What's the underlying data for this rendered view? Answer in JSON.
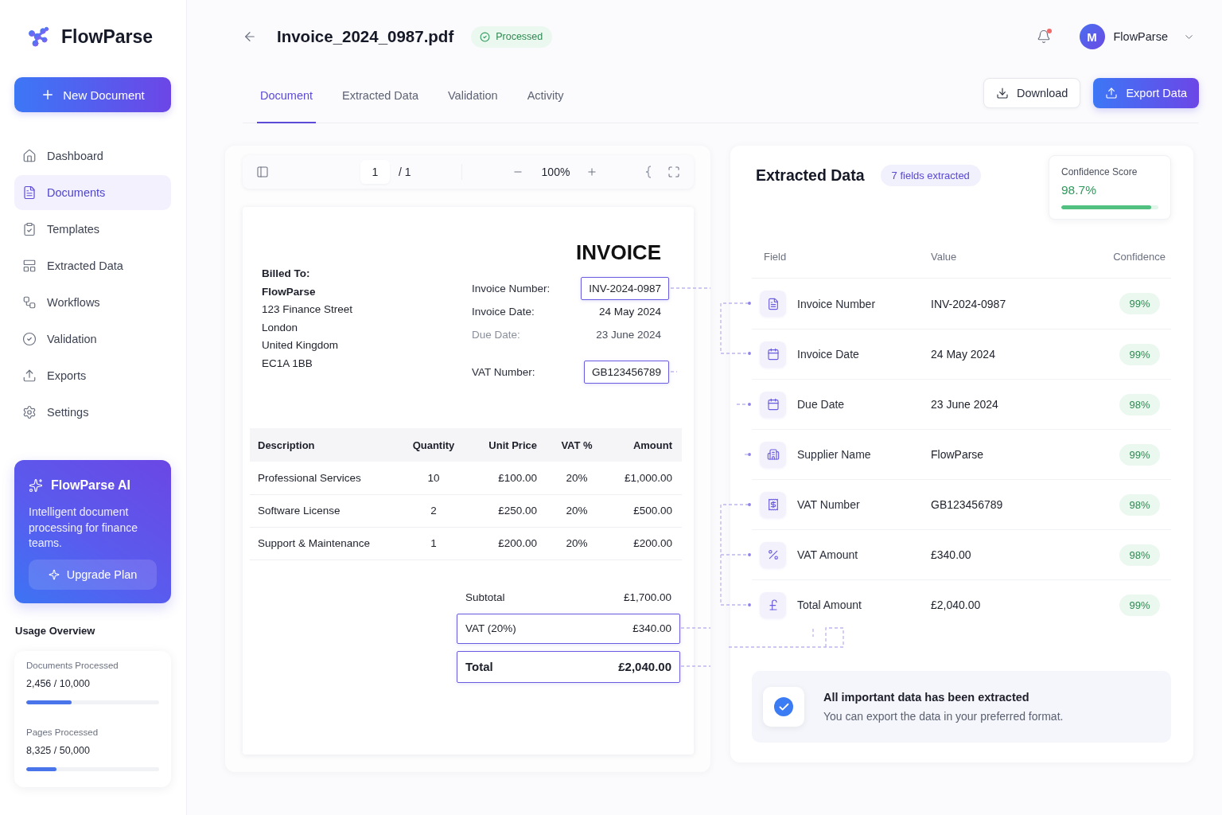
{
  "sidebar": {
    "brand": "FlowParse",
    "new_button": "New Document",
    "nav": [
      {
        "label": "Dashboard",
        "selected": false
      },
      {
        "label": "Documents",
        "selected": true
      },
      {
        "label": "Templates",
        "selected": false
      },
      {
        "label": "Extracted Data",
        "selected": false
      },
      {
        "label": "Workflows",
        "selected": false
      },
      {
        "label": "Validation",
        "selected": false
      },
      {
        "label": "Exports",
        "selected": false
      },
      {
        "label": "Settings",
        "selected": false
      }
    ],
    "promo": {
      "title": "FlowParse AI",
      "text": "Intelligent document processing for finance teams.",
      "button": "Upgrade Plan"
    },
    "usage": {
      "title": "Usage Overview",
      "meters": [
        {
          "label": "Documents Processed",
          "reading": "2,456 / 10,000",
          "level": 0.34
        },
        {
          "label": "Pages Processed",
          "reading": "8,325 / 50,000",
          "level": 0.23
        }
      ]
    }
  },
  "header": {
    "title": "Invoice_2024_0987.pdf",
    "status": "Processed",
    "notifications": {
      "unread": true
    },
    "user": {
      "initial": "M",
      "name": "FlowParse"
    },
    "tabs": [
      {
        "label": "Document",
        "selected": true
      },
      {
        "label": "Extracted Data",
        "selected": false
      },
      {
        "label": "Validation",
        "selected": false
      },
      {
        "label": "Activity",
        "selected": false
      }
    ],
    "actions": [
      {
        "label": "Download",
        "kind": "secondary"
      },
      {
        "label": "Export Data",
        "kind": "primary"
      }
    ]
  },
  "viewer": {
    "toolbar": {
      "page": "1",
      "page_count": "/ 1",
      "zoom": "100%"
    },
    "document": {
      "title": "INVOICE",
      "billed_to": {
        "heading": "Billed To:",
        "name": "FlowParse",
        "lines": [
          "123 Finance Street",
          "London",
          "United Kingdom",
          "EC1A 1BB"
        ]
      },
      "meta": [
        {
          "label": "Invoice Number:",
          "value": "INV-2024-0987",
          "highlighted": true,
          "muted": false
        },
        {
          "label": "Invoice Date:",
          "value": "24 May 2024",
          "highlighted": false,
          "muted": false
        },
        {
          "label": "Due Date:",
          "value": "23 June 2024",
          "highlighted": false,
          "muted": true
        },
        {
          "label": "VAT Number:",
          "value": "GB123456789",
          "highlighted": true,
          "muted": false
        }
      ],
      "items": {
        "columns": [
          "Description",
          "Quantity",
          "Unit Price",
          "VAT %",
          "Amount"
        ],
        "rows": [
          [
            "Professional Services",
            "10",
            "£100.00",
            "20%",
            "£1,000.00"
          ],
          [
            "Software License",
            "2",
            "£250.00",
            "20%",
            "£500.00"
          ],
          [
            "Support & Maintenance",
            "1",
            "£200.00",
            "20%",
            "£200.00"
          ]
        ]
      },
      "totals": [
        {
          "label": "Subtotal",
          "value": "£1,700.00",
          "highlighted": false,
          "kind": "line"
        },
        {
          "label": "VAT (20%)",
          "value": "£340.00",
          "highlighted": true,
          "kind": "line"
        },
        {
          "label": "Total",
          "value": "£2,040.00",
          "highlighted": true,
          "kind": "grand"
        }
      ]
    }
  },
  "extracted": {
    "title": "Extracted Data",
    "count": "7 fields extracted",
    "confidence": {
      "label": "Confidence Score",
      "value": "98.7%",
      "level": 0.93
    },
    "columns": [
      "Field",
      "Value",
      "Confidence"
    ],
    "fields": [
      {
        "name": "Invoice Number",
        "value": "INV-2024-0987",
        "confidence": "99%"
      },
      {
        "name": "Invoice Date",
        "value": "24 May 2024",
        "confidence": "99%"
      },
      {
        "name": "Due Date",
        "value": "23 June 2024",
        "confidence": "98%"
      },
      {
        "name": "Supplier Name",
        "value": "FlowParse",
        "confidence": "99%"
      },
      {
        "name": "VAT Number",
        "value": "GB123456789",
        "confidence": "98%"
      },
      {
        "name": "VAT Amount",
        "value": "£340.00",
        "confidence": "98%"
      },
      {
        "name": "Total Amount",
        "value": "£2,040.00",
        "confidence": "99%"
      }
    ],
    "notice": {
      "title": "All important data has been extracted",
      "text": "You can export the data in your preferred format."
    }
  }
}
